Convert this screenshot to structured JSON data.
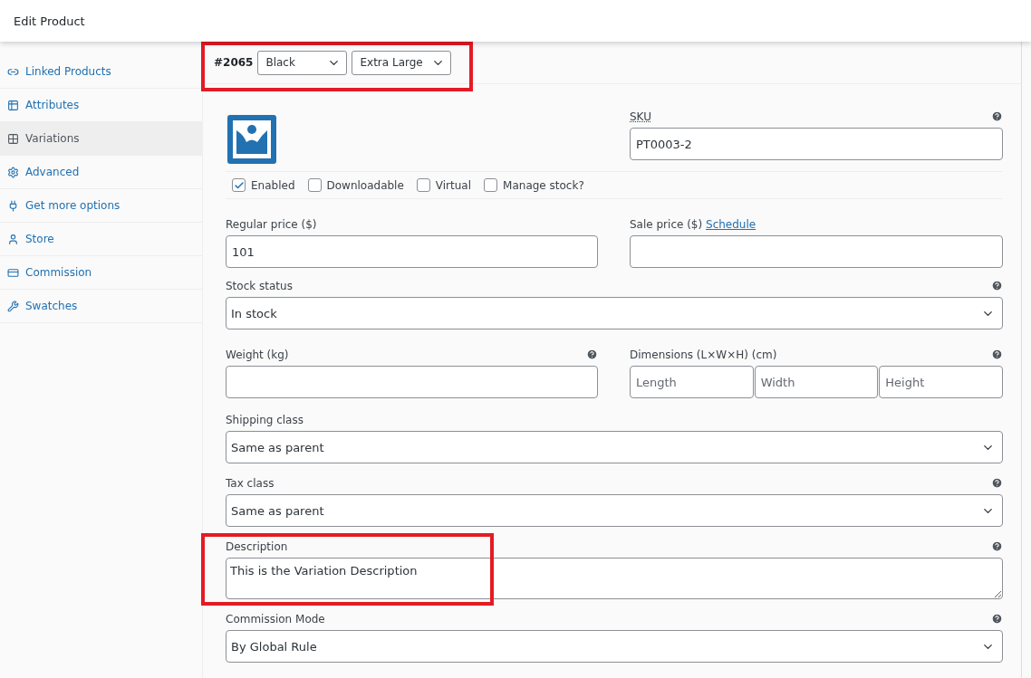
{
  "header": {
    "title": "Edit Product"
  },
  "sidebar": {
    "items": [
      {
        "label": "Linked Products",
        "selected": false
      },
      {
        "label": "Attributes",
        "selected": false
      },
      {
        "label": "Variations",
        "selected": true
      },
      {
        "label": "Advanced",
        "selected": false
      },
      {
        "label": "Get more options",
        "selected": false
      },
      {
        "label": "Store",
        "selected": false
      },
      {
        "label": "Commission",
        "selected": false
      },
      {
        "label": "Swatches",
        "selected": false
      }
    ]
  },
  "variation": {
    "id": "#2065",
    "highlighted": true,
    "attributes": [
      {
        "value": "Black"
      },
      {
        "value": "Extra Large"
      }
    ]
  },
  "form": {
    "sku": {
      "label": "SKU",
      "value": "PT0003-2"
    },
    "options": [
      {
        "label": "Enabled",
        "checked": true
      },
      {
        "label": "Downloadable",
        "checked": false
      },
      {
        "label": "Virtual",
        "checked": false
      },
      {
        "label": "Manage stock?",
        "checked": false
      }
    ],
    "regular_price": {
      "label": "Regular price ($)",
      "value": "101"
    },
    "sale_price": {
      "label": "Sale price ($)",
      "link": "Schedule"
    },
    "stock_status": {
      "label": "Stock status",
      "value": "In stock"
    },
    "weight": {
      "label": "Weight (kg)"
    },
    "dimensions": {
      "label": "Dimensions (L×W×H) (cm)",
      "placeholders": [
        "Length",
        "Width",
        "Height"
      ]
    },
    "shipping_class": {
      "label": "Shipping class",
      "value": "Same as parent"
    },
    "tax_class": {
      "label": "Tax class",
      "value": "Same as parent"
    },
    "description": {
      "label": "Description",
      "value": "This is the Variation Description",
      "highlighted": true
    },
    "commission_mode": {
      "label": "Commission Mode",
      "value": "By Global Rule"
    }
  }
}
